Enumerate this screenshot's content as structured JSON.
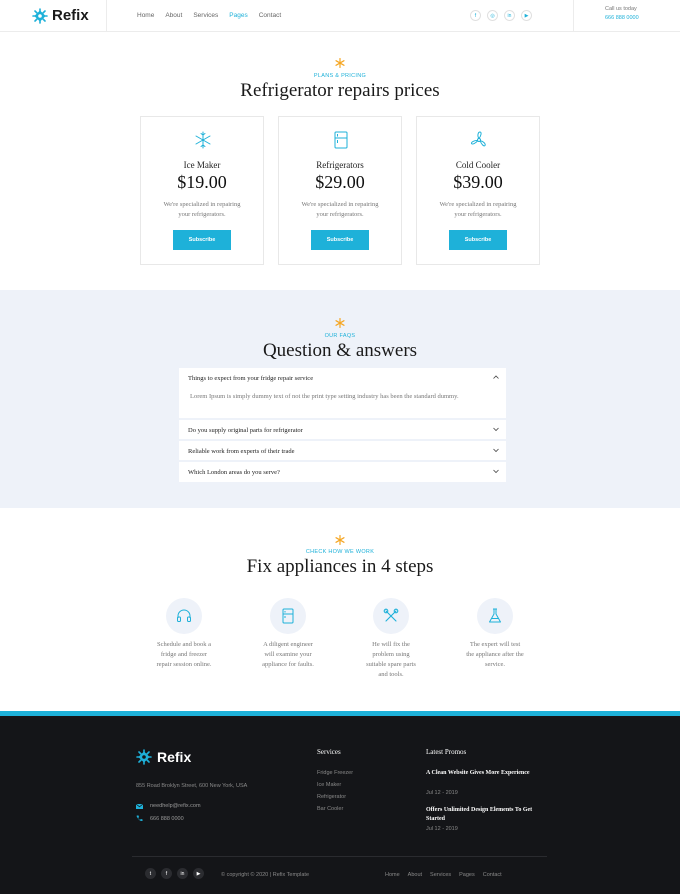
{
  "brand": {
    "name": "Refix",
    "accent": "#1eb1d9",
    "icon": "snowflake-logo-icon"
  },
  "nav": {
    "items": [
      "Home",
      "About",
      "Services",
      "Pages",
      "Contact"
    ],
    "active": "Pages"
  },
  "header": {
    "socials": [
      "facebook-icon",
      "instagram-icon",
      "linkedin-icon",
      "youtube-icon"
    ],
    "call_label": "Call us today",
    "call_number": "666 888 0000"
  },
  "pricing": {
    "eyebrow": "PLANS & PRICING",
    "title": "Refrigerator repairs prices",
    "cards": [
      {
        "name": "Ice Maker",
        "price": "$19.00",
        "desc": "We're specialized in repairing your refrigerators.",
        "button": "Subscribe",
        "icon": "snowflake-icon"
      },
      {
        "name": "Refrigerators",
        "price": "$29.00",
        "desc": "We're specialized in repairing your refrigerators.",
        "button": "Subscribe",
        "icon": "fridge-icon"
      },
      {
        "name": "Cold Cooler",
        "price": "$39.00",
        "desc": "We're specialized in repairing your refrigerators.",
        "button": "Subscribe",
        "icon": "fan-icon"
      }
    ]
  },
  "faq": {
    "eyebrow": "OUR FAQS",
    "title": "Question & answers",
    "items": [
      {
        "q": "Things to expect from your fridge repair  service",
        "a": "Lorem Ipsum is simply dummy text of not the print type setting industry has been the standard dummy.",
        "open": true
      },
      {
        "q": "Do you supply original parts for  refrigerator",
        "open": false
      },
      {
        "q": "Reliable work from experts of their trade",
        "open": false
      },
      {
        "q": "Which London areas do you serve?",
        "open": false
      }
    ]
  },
  "steps": {
    "eyebrow": "CHECK HOW WE WORK",
    "title": "Fix appliances in 4 steps",
    "items": [
      {
        "icon": "headset-icon",
        "lines": [
          "Schedule and book a",
          "fridge and freezer",
          "repair session online."
        ]
      },
      {
        "icon": "fridge-icon",
        "lines": [
          "A diligent engineer",
          "will examine your",
          "appliance for faults."
        ]
      },
      {
        "icon": "tools-icon",
        "lines": [
          "He will fix the",
          "problem using",
          "suitable spare parts",
          "and tools."
        ]
      },
      {
        "icon": "flask-icon",
        "lines": [
          "The expert will test",
          "the appliance after the",
          "service."
        ]
      }
    ]
  },
  "footer": {
    "address": "855 Road Broklyn Street, 600 New York, USA",
    "email": "needhelp@refix.com",
    "phone": "666 888 0000",
    "services_heading": "Services",
    "services": [
      "Fridge Freezer",
      "Ice Maker",
      "Refrigerator",
      "Bar Cooler"
    ],
    "promos_heading": "Latest Promos",
    "promos": [
      {
        "title": "A Clean Website Gives More Experience",
        "date": "Jul 12 - 2019"
      },
      {
        "title": "Offers Unlimited Design Elements To Get Started",
        "date": "Jul 12 - 2019"
      }
    ],
    "socials": [
      "twitter-icon",
      "facebook-icon",
      "linkedin-icon",
      "youtube-icon"
    ],
    "copyright": "© copyright © 2020 | Refix Template",
    "nav": [
      "Home",
      "About",
      "Services",
      "Pages",
      "Contact"
    ]
  }
}
